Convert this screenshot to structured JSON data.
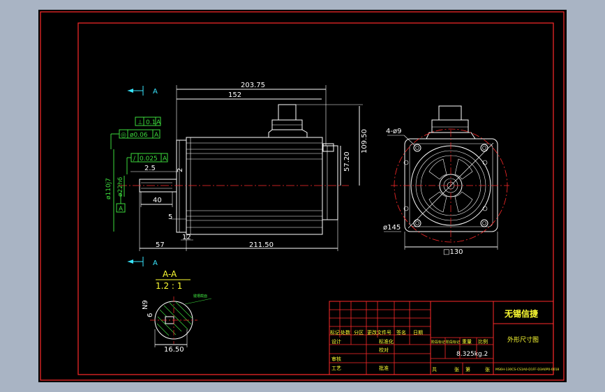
{
  "section": {
    "marker_top": "A",
    "marker_bottom": "A",
    "title": "A-A",
    "scale": "1.2 : 1"
  },
  "side_view": {
    "dims": {
      "d203_75": "203.75",
      "d152": "152",
      "d109_50": "109.50",
      "d57_20": "57.20",
      "d2_5": "2.5",
      "d2": "2",
      "d40": "40",
      "d5": "5",
      "d12": "12",
      "d57": "57",
      "d211_50": "211.50",
      "dia_shaft": "ø22h6",
      "dia_pilot": "ø110j7"
    },
    "tolerances": {
      "perp_sym": "⊥",
      "perp_val": "0.1",
      "perp_ref": "A",
      "conc_sym": "◎",
      "conc_val": "ø0.06",
      "conc_ref": "A",
      "runout_sym": "∕",
      "runout_val": "0.025",
      "runout_ref": "A",
      "datum": "A"
    }
  },
  "front_view": {
    "holes": "4-ø9",
    "bolt_circle": "ø145",
    "flange": "□130"
  },
  "shaft_section": {
    "key_width": "N9",
    "key_depth": "6",
    "diameter": "16.50",
    "note": "键槽截面"
  },
  "title_block": {
    "company": "无锡信捷",
    "drawing_name": "外形尺寸图",
    "part_no": "MS6H-130CS-CS1A0-D1FF-D3A0P0-0018",
    "weight": "8.325kg.2",
    "cols": [
      "标记",
      "处数",
      "分区",
      "更改文件号",
      "签名",
      "日期"
    ],
    "row_design": "设计",
    "row_standard": "标准化",
    "row_check": "校对",
    "row_review": "审核",
    "row_process": "工艺",
    "row_approve": "批准",
    "stage_label": "阶段标记",
    "weight_label": "重量",
    "scale_label": "比例",
    "sheet_total": "共",
    "sheet_total_unit": "张",
    "sheet_no": "第",
    "sheet_no_unit": "张"
  }
}
